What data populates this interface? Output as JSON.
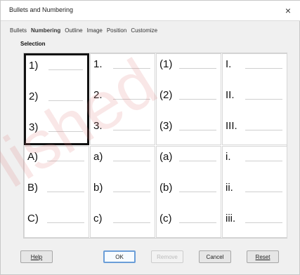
{
  "dialog": {
    "title": "Bullets and Numbering",
    "close_glyph": "×"
  },
  "tabs": [
    {
      "label": "Bullets",
      "active": false
    },
    {
      "label": "Numbering",
      "active": true
    },
    {
      "label": "Outline",
      "active": false
    },
    {
      "label": "Image",
      "active": false
    },
    {
      "label": "Position",
      "active": false
    },
    {
      "label": "Customize",
      "active": false
    }
  ],
  "selection_label": "Selection",
  "styles": [
    {
      "items": [
        "1)",
        "2)",
        "3)"
      ],
      "selected": true
    },
    {
      "items": [
        "1.",
        "2.",
        "3."
      ],
      "selected": false
    },
    {
      "items": [
        "(1)",
        "(2)",
        "(3)"
      ],
      "selected": false
    },
    {
      "items": [
        "I.",
        "II.",
        "III."
      ],
      "selected": false
    },
    {
      "items": [
        "A)",
        "B)",
        "C)"
      ],
      "selected": false
    },
    {
      "items": [
        "a)",
        "b)",
        "c)"
      ],
      "selected": false
    },
    {
      "items": [
        "(a)",
        "(b)",
        "(c)"
      ],
      "selected": false
    },
    {
      "items": [
        "i.",
        "ii.",
        "iii."
      ],
      "selected": false
    }
  ],
  "buttons": {
    "help": "Help",
    "ok": "OK",
    "remove": "Remove",
    "cancel": "Cancel",
    "reset": "Reset"
  },
  "watermark": "lished"
}
